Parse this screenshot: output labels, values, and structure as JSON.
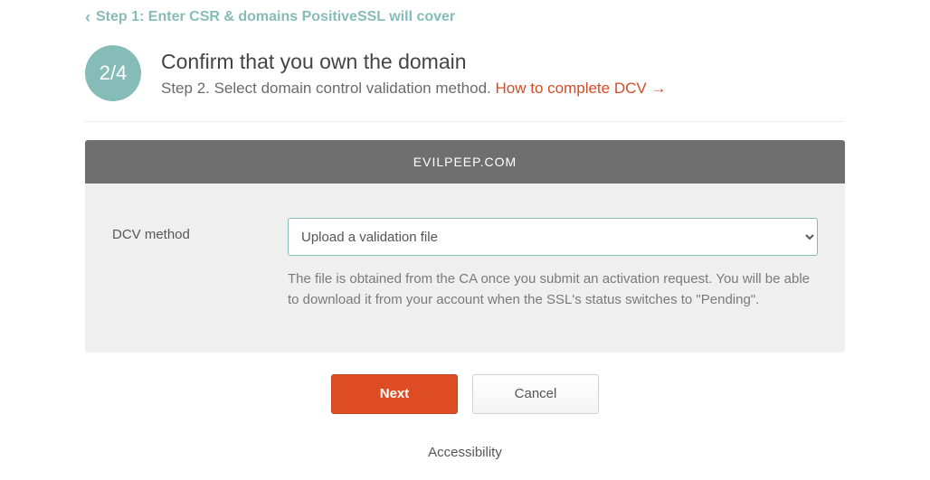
{
  "back": {
    "label": "Step 1: Enter CSR & domains PositiveSSL will cover"
  },
  "step": {
    "badge": "2/4",
    "title": "Confirm that you own the domain",
    "subtitle_prefix": "Step 2. Select domain control validation method. ",
    "subtitle_link": "How to complete DCV →"
  },
  "panel": {
    "domain": "EVILPEEP.COM",
    "field_label": "DCV method",
    "selected_option": "Upload a validation file",
    "help_text": "The file is obtained from the CA once you submit an activation request. You will be able to download it from your account when the SSL's status switches to \"Pending\"."
  },
  "actions": {
    "next": "Next",
    "cancel": "Cancel"
  },
  "footer": {
    "accessibility": "Accessibility"
  }
}
